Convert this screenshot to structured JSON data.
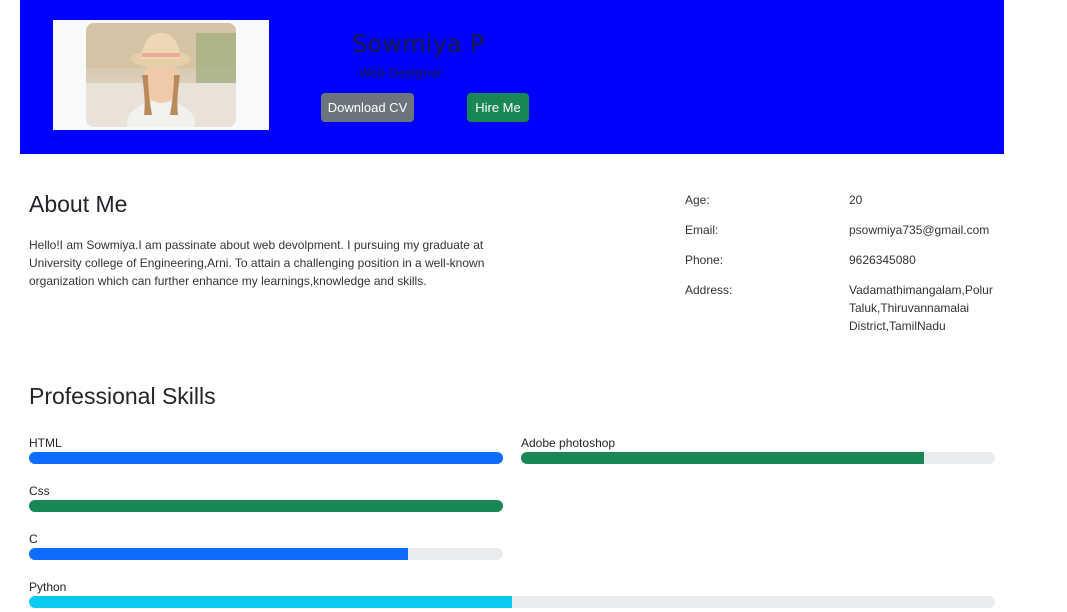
{
  "header": {
    "name": "Sowmiya P",
    "role": "Web Designer",
    "download_label": "Download CV",
    "hire_label": "Hire Me",
    "background": "#0000ff"
  },
  "about": {
    "title": "About Me",
    "text": "Hello!I am Sowmiya.I am passinate about web devolpment. I pursuing my graduate at University college of Engineering,Arni. To attain a challenging position in a well-known organization which can further enhance my learnings,knowledge and skills."
  },
  "info": {
    "age_label": "Age:",
    "age": "20",
    "email_label": "Email:",
    "email": "psowmiya735@gmail.com",
    "phone_label": "Phone:",
    "phone": "9626345080",
    "address_label": "Address:",
    "address": "Vadamathimangalam,Polur Taluk,Thiruvannamalai District,TamilNadu"
  },
  "skills": {
    "title": "Professional Skills",
    "items": [
      {
        "name": "HTML",
        "level": 1.0,
        "color": "#0d6efd"
      },
      {
        "name": "Adobe photoshop",
        "level": 0.85,
        "color": "#198754"
      },
      {
        "name": "Css",
        "level": 1.0,
        "color": "#198754"
      },
      {
        "name": "C",
        "level": 0.8,
        "color": "#0d6efd"
      },
      {
        "name": "Python",
        "level": 0.5,
        "color": "#0dcaf0"
      }
    ]
  }
}
